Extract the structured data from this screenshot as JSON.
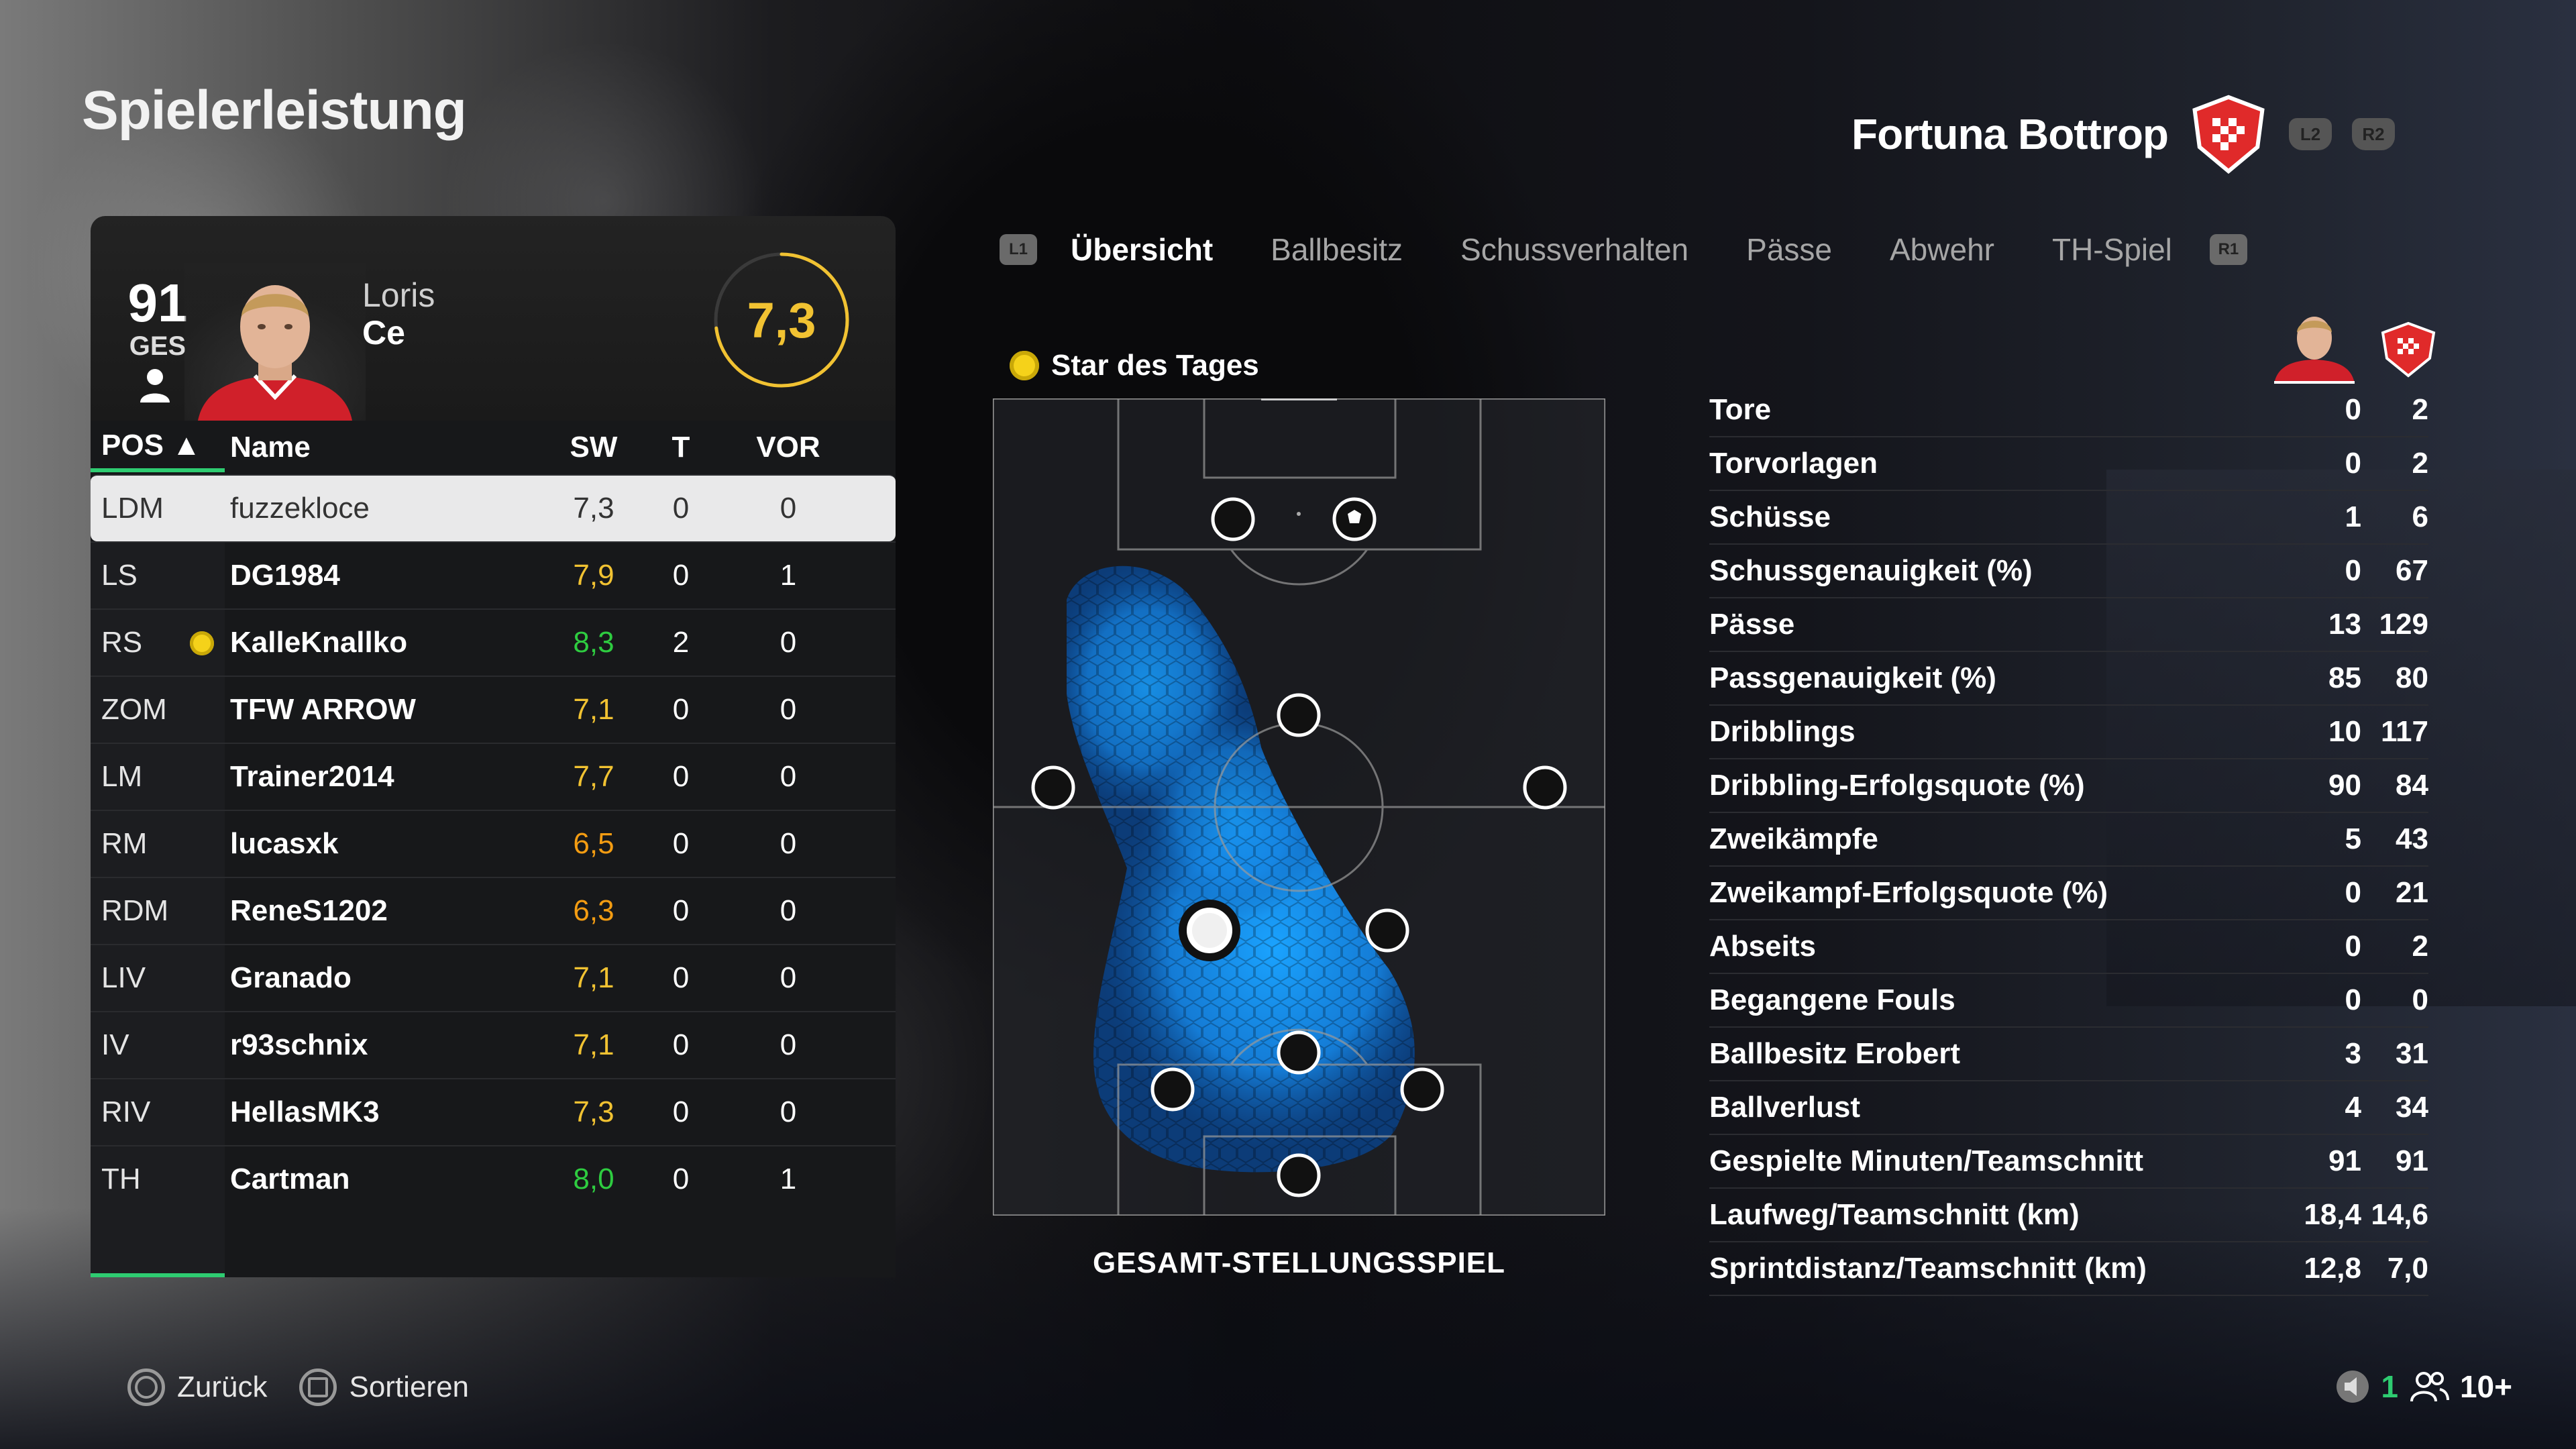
{
  "page": {
    "title": "Spielerleistung"
  },
  "team": {
    "name": "Fortuna Bottrop",
    "l2": "L2",
    "r2": "R2"
  },
  "player": {
    "overall": "91",
    "overall_label": "GES",
    "first_name": "Loris",
    "last_name": "Ce",
    "match_rating": "7,3"
  },
  "table": {
    "headers": {
      "pos": "POS ▲",
      "name": "Name",
      "sw": "SW",
      "t": "T",
      "vor": "VOR"
    },
    "rows": [
      {
        "pos": "LDM",
        "name": "fuzzekloce",
        "sw": "7,3",
        "t": "0",
        "vor": "0",
        "sw_color": "#333333"
      },
      {
        "pos": "LS",
        "name": "DG1984",
        "sw": "7,9",
        "t": "0",
        "vor": "1",
        "sw_color": "#f1c232"
      },
      {
        "pos": "RS",
        "name": "KalleKnallko",
        "sw": "8,3",
        "t": "2",
        "vor": "0",
        "sw_color": "#2ecc40"
      },
      {
        "pos": "ZOM",
        "name": "TFW ARROW",
        "sw": "7,1",
        "t": "0",
        "vor": "0",
        "sw_color": "#f1c232"
      },
      {
        "pos": "LM",
        "name": "Trainer2014",
        "sw": "7,7",
        "t": "0",
        "vor": "0",
        "sw_color": "#f1c232"
      },
      {
        "pos": "RM",
        "name": "lucasxk",
        "sw": "6,5",
        "t": "0",
        "vor": "0",
        "sw_color": "#f39c12"
      },
      {
        "pos": "RDM",
        "name": "ReneS1202",
        "sw": "6,3",
        "t": "0",
        "vor": "0",
        "sw_color": "#f39c12"
      },
      {
        "pos": "LIV",
        "name": "Granado",
        "sw": "7,1",
        "t": "0",
        "vor": "0",
        "sw_color": "#f1c232"
      },
      {
        "pos": "IV",
        "name": "r93schnix",
        "sw": "7,1",
        "t": "0",
        "vor": "0",
        "sw_color": "#f1c232"
      },
      {
        "pos": "RIV",
        "name": "HellasMK3",
        "sw": "7,3",
        "t": "0",
        "vor": "0",
        "sw_color": "#f1c232"
      },
      {
        "pos": "TH",
        "name": "Cartman",
        "sw": "8,0",
        "t": "0",
        "vor": "1",
        "sw_color": "#2ecc40"
      }
    ]
  },
  "tabs": {
    "l1": "L1",
    "r1": "R1",
    "items": [
      "Übersicht",
      "Ballbesitz",
      "Schussverhalten",
      "Pässe",
      "Abwehr",
      "TH-Spiel"
    ]
  },
  "star_of_day": "Star des Tages",
  "pitch_label": "GESAMT-STELLUNGSSPIEL",
  "stats": [
    {
      "label": "Tore",
      "player": "0",
      "team": "2"
    },
    {
      "label": "Torvorlagen",
      "player": "0",
      "team": "2"
    },
    {
      "label": "Schüsse",
      "player": "1",
      "team": "6"
    },
    {
      "label": "Schussgenauigkeit (%)",
      "player": "0",
      "team": "67"
    },
    {
      "label": "Pässe",
      "player": "13",
      "team": "129"
    },
    {
      "label": "Passgenauigkeit (%)",
      "player": "85",
      "team": "80"
    },
    {
      "label": "Dribblings",
      "player": "10",
      "team": "117"
    },
    {
      "label": "Dribbling-Erfolgsquote (%)",
      "player": "90",
      "team": "84"
    },
    {
      "label": "Zweikämpfe",
      "player": "5",
      "team": "43"
    },
    {
      "label": "Zweikampf-Erfolgsquote (%)",
      "player": "0",
      "team": "21"
    },
    {
      "label": "Abseits",
      "player": "0",
      "team": "2"
    },
    {
      "label": "Begangene Fouls",
      "player": "0",
      "team": "0"
    },
    {
      "label": "Ballbesitz Erobert",
      "player": "3",
      "team": "31"
    },
    {
      "label": "Ballverlust",
      "player": "4",
      "team": "34"
    },
    {
      "label": "Gespielte Minuten/Teamschnitt",
      "player": "91",
      "team": "91"
    },
    {
      "label": "Laufweg/Teamschnitt (km)",
      "player": "18,4",
      "team": "14,6"
    },
    {
      "label": "Sprintdistanz/Teamschnitt (km)",
      "player": "12,8",
      "team": "7,0"
    }
  ],
  "footer": {
    "back": "Zurück",
    "sort": "Sortieren",
    "count": "1",
    "friends": "10+"
  },
  "colors": {
    "accent_green": "#2ecc71",
    "rating_yellow": "#f1c232",
    "heat_blue": "#1e9bff"
  }
}
